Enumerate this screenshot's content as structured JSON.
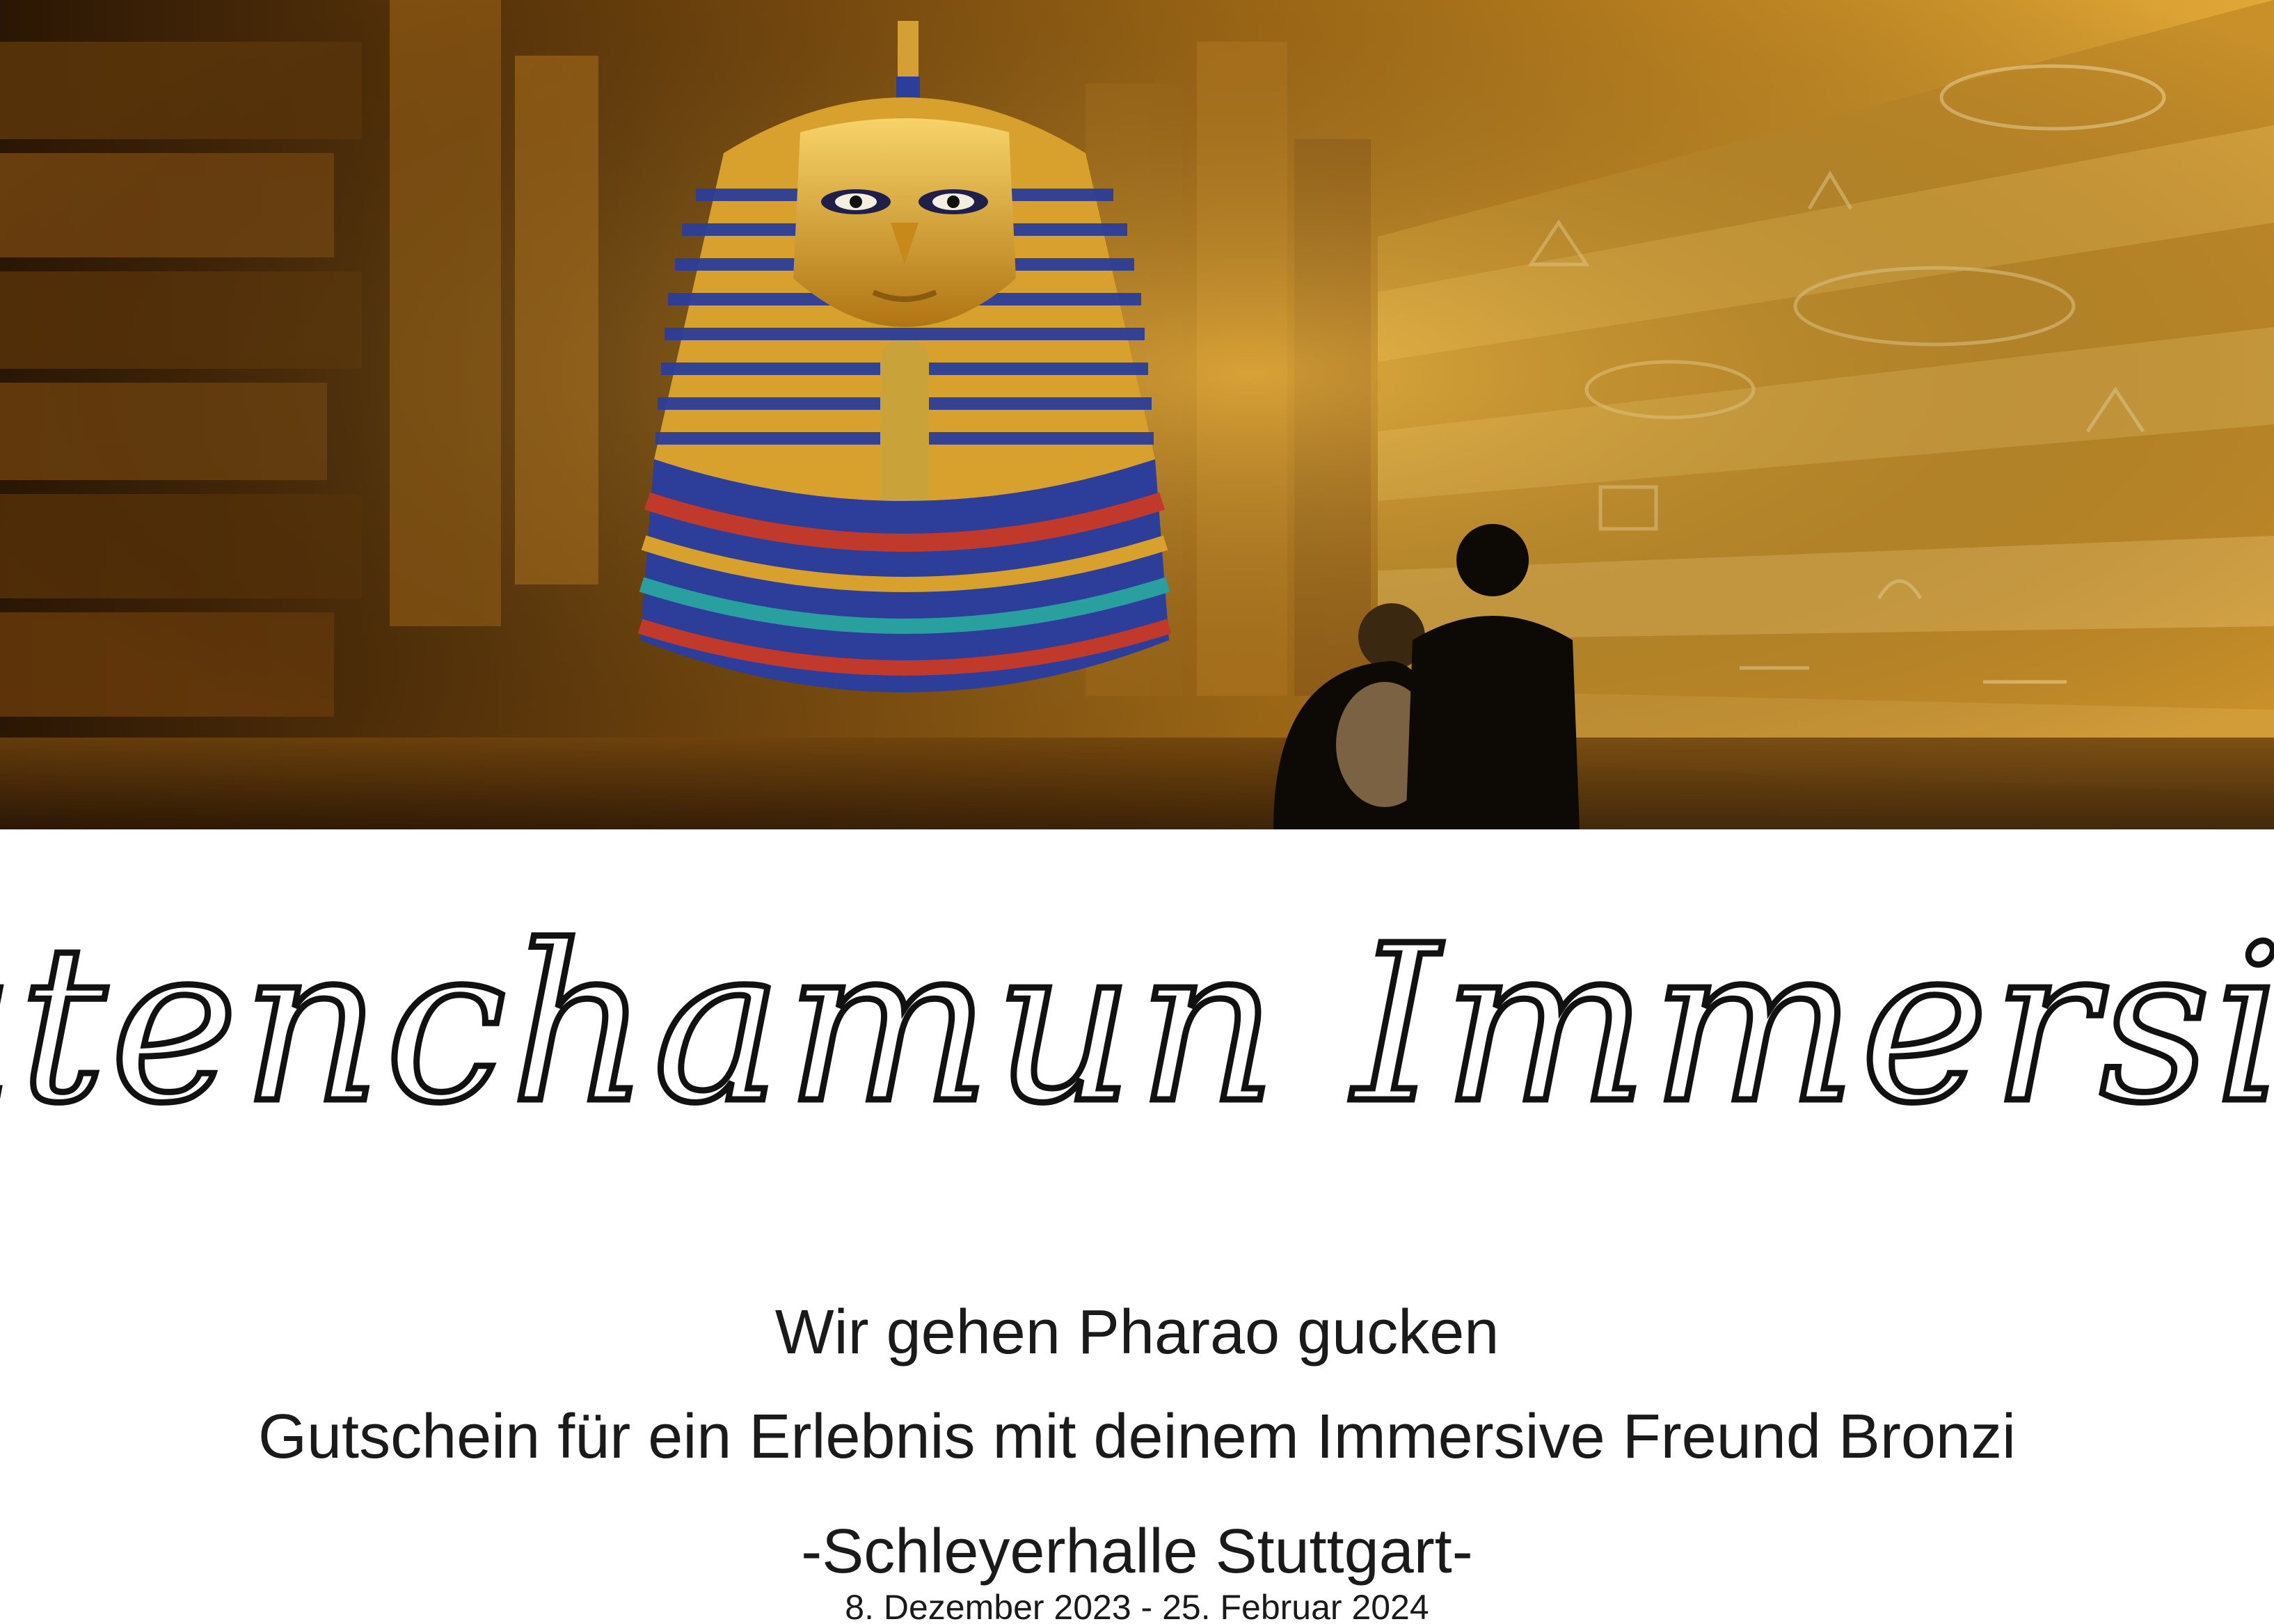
{
  "hero_image": {
    "subject": "pharaoh-mask-in-golden-hieroglyph-hall"
  },
  "title": {
    "text": "Tutenchamun Immersive"
  },
  "subtitle": "Wir gehen Pharao gucken",
  "voucher_text": "Gutschein für ein Erlebnis mit deinem Immersive Freund Bronzi",
  "venue": "-Schleyerhalle Stuttgart-",
  "dates": "8. Dezember 2023 - 25. Februar 2024",
  "colors": {
    "gold": "#d79a25",
    "dark_bronze": "#3a2408",
    "lapis_blue": "#2c3d9a",
    "text": "#1a1a1a"
  }
}
